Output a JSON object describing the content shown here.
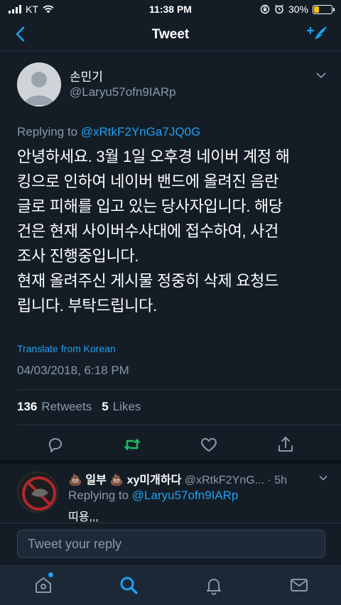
{
  "status_bar": {
    "carrier": "KT",
    "time": "11:38 PM",
    "battery_percent": "30%",
    "battery_level": 0.3,
    "icons": [
      "signal-icon",
      "wifi-icon",
      "rotation-lock-icon",
      "alarm-icon",
      "battery-icon"
    ]
  },
  "nav": {
    "title": "Tweet",
    "back_icon": "back-chevron-icon",
    "compose_icon": "compose-tweet-icon"
  },
  "tweet": {
    "author_name": "손민기",
    "author_handle": "@Laryu57ofn9IARp",
    "replying_prefix": "Replying to",
    "replying_handle": "@xRtkF2YnGa7JQ0G",
    "body": "안녕하세요. 3월 1일 오후경 네이버 계정 해\n킹으로 인하여 네이버 밴드에 올려진 음란\n글로 피해를 입고 있는 당사자입니다. 해당\n건은 현재 사이버수사대에 접수하여, 사건\n조사 진행중입니다.\n현재 올려주신 게시물 정중히 삭제 요청드\n립니다. 부탁드립니다.",
    "translate_label": "Translate from Korean",
    "timestamp": "04/03/2018, 6:18 PM",
    "retweets_count": "136",
    "retweets_label": "Retweets",
    "likes_count": "5",
    "likes_label": "Likes",
    "actions": [
      "reply-icon",
      "retweet-icon",
      "like-icon",
      "share-icon"
    ]
  },
  "reply": {
    "author_name": "💩 일부 💩 xy미개하다",
    "author_handle": "@xRtkF2YnG...",
    "age": "· 5h",
    "replying_prefix": "Replying to",
    "replying_handle": "@Laryu57ofn9IARp",
    "text": "띠용,,,"
  },
  "composer": {
    "placeholder": "Tweet your reply"
  },
  "tab_bar": {
    "items": [
      "home-icon",
      "search-icon",
      "notifications-icon",
      "messages-icon"
    ],
    "active": "search-icon"
  },
  "colors": {
    "background": "#141d26",
    "accent": "#1da1f2",
    "secondary_text": "#8899a6",
    "retweet_green": "#17bf63",
    "battery_yellow": "#f5c518"
  }
}
